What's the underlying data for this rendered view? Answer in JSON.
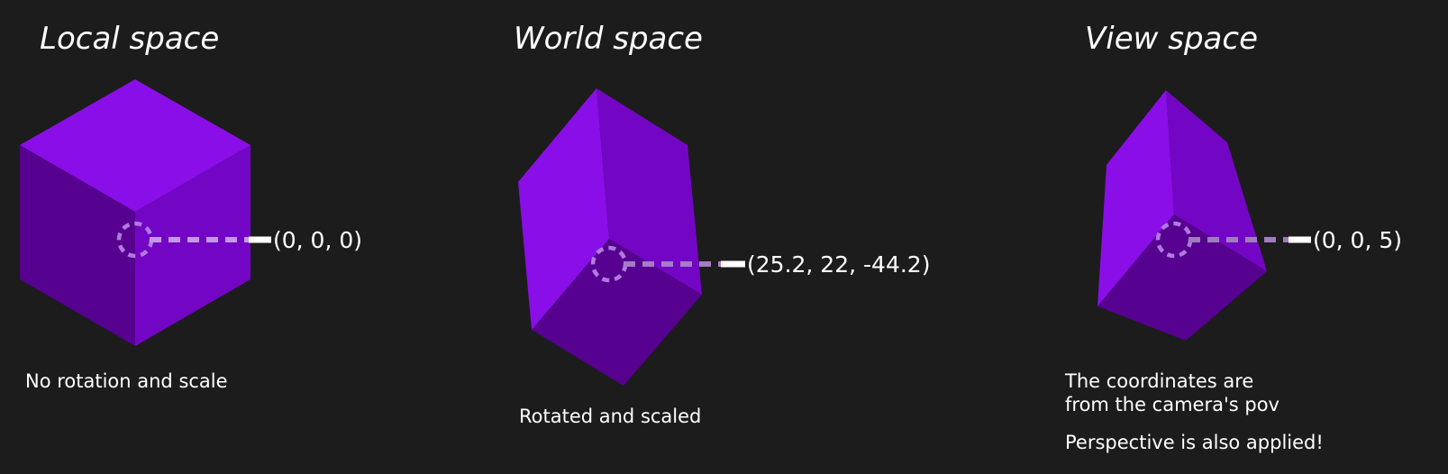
{
  "panels": {
    "local": {
      "title": "Local space",
      "coordinates": "(0, 0, 0)",
      "caption": "No rotation and scale"
    },
    "world": {
      "title": "World space",
      "coordinates": "(25.2, 22, -44.2)",
      "caption": "Rotated and scaled"
    },
    "view": {
      "title": "View space",
      "coordinates": "(0, 0, 5)",
      "caption_line_1": "The coordinates are",
      "caption_line_2": "from the camera's pov",
      "note": "Perspective is also applied!"
    }
  },
  "colors": {
    "background": "#1c1c1c",
    "face_top": "#8a0ee8",
    "face_left": "#56018f",
    "face_right": "#7306c4",
    "origin_marker": "#b07ae0",
    "leader_line": "#ffffff",
    "text": "#ffffff"
  }
}
